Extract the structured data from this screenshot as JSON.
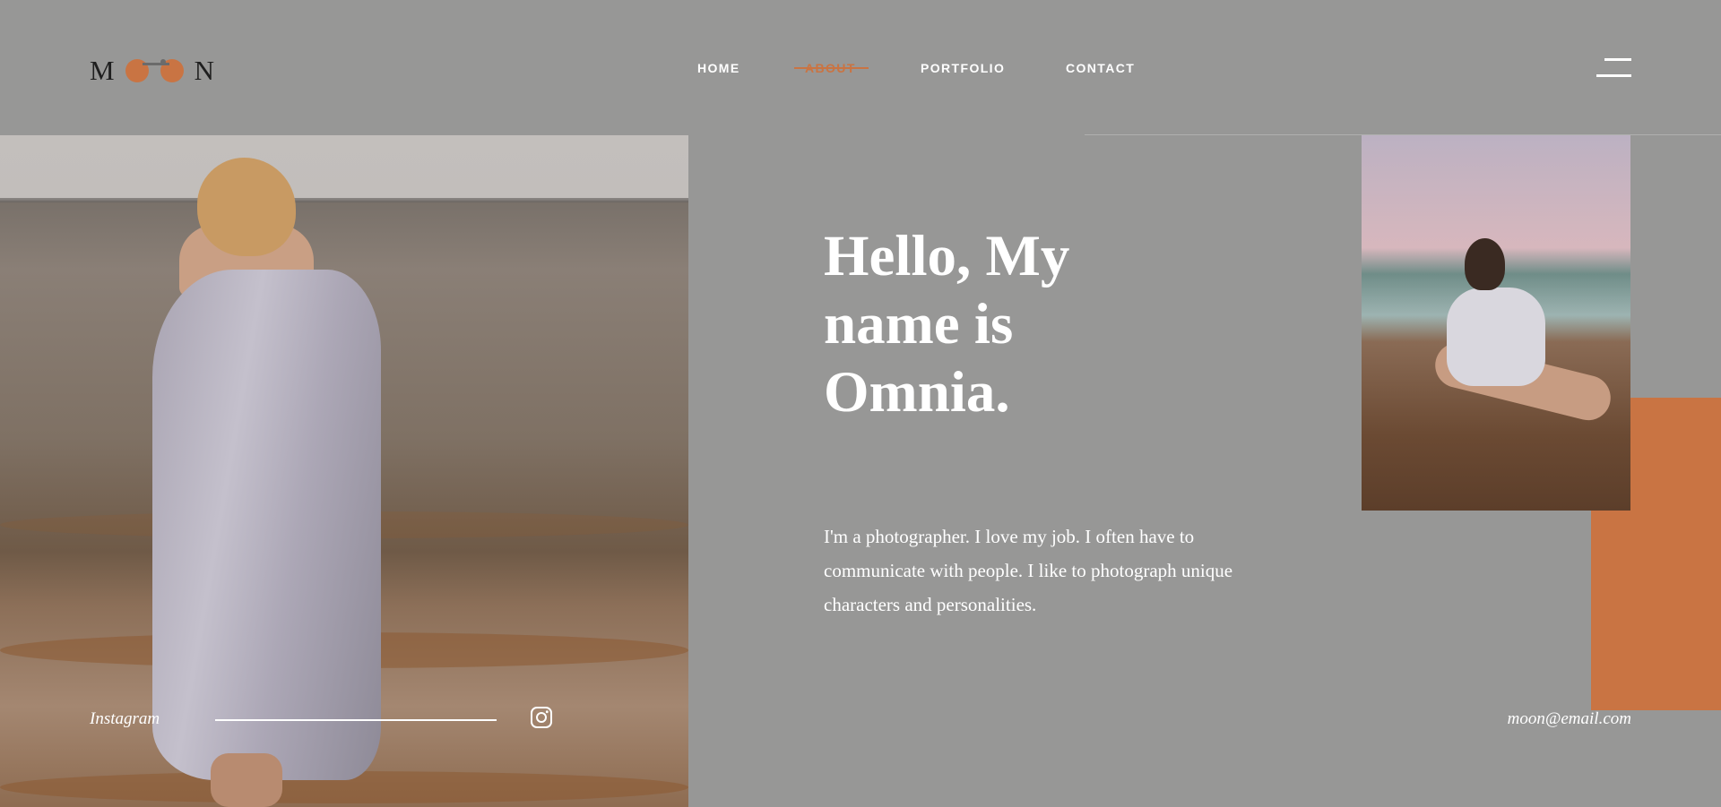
{
  "brand": {
    "logo_left": "M",
    "logo_right": "N",
    "accent_color": "#c97443"
  },
  "nav": {
    "items": [
      {
        "label": "HOME",
        "active": false
      },
      {
        "label": "ABOUT",
        "active": true
      },
      {
        "label": "PORTFOLIO",
        "active": false
      },
      {
        "label": "CONTACT",
        "active": false
      }
    ]
  },
  "hero": {
    "headline": "Hello, My name is Omnia.",
    "intro": "I'm a photographer. I love my job. I often have to communicate with people. I like to photograph unique characters and personalities."
  },
  "social": {
    "label": "Instagram",
    "icon": "instagram-icon"
  },
  "contact": {
    "email": "moon@email.com"
  },
  "icons": {
    "menu": "hamburger-menu-icon"
  }
}
